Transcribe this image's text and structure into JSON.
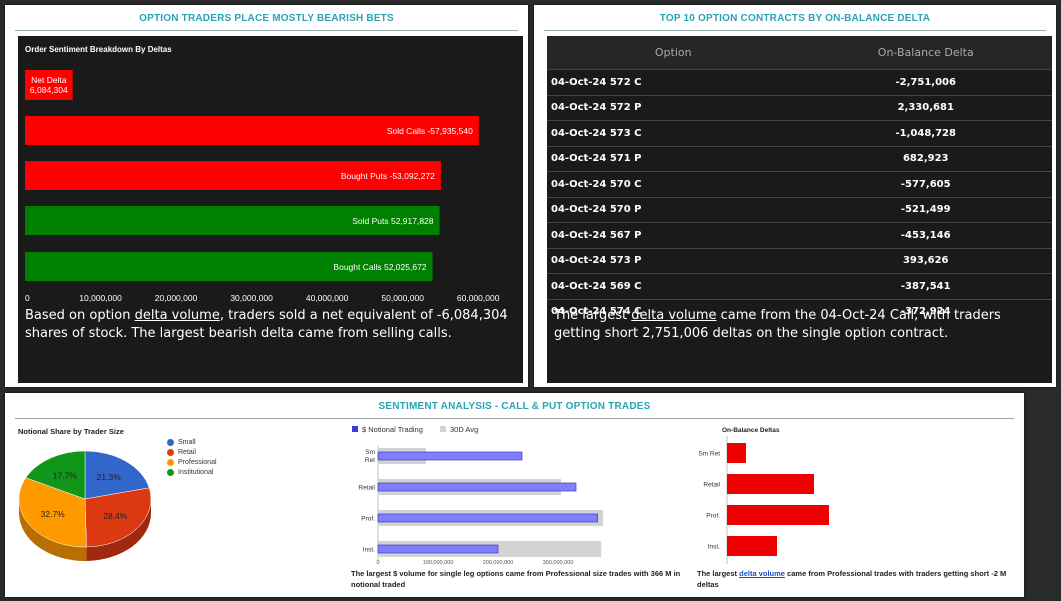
{
  "panel1": {
    "title": "OPTION TRADERS PLACE MOSTLY BEARISH BETS",
    "chart_title": "Order Sentiment Breakdown By Deltas",
    "description_pre": "Based on option ",
    "description_link": "delta volume",
    "description_post": ", traders sold a net equivalent of -6,084,304 shares of stock. The largest bearish delta came from selling calls."
  },
  "panel2": {
    "title": "TOP 10 OPTION CONTRACTS BY ON-BALANCE DELTA",
    "headers": [
      "Option",
      "On-Balance Delta"
    ],
    "rows": [
      [
        "04-Oct-24 572 C",
        "-2,751,006"
      ],
      [
        "04-Oct-24 572 P",
        "2,330,681"
      ],
      [
        "04-Oct-24 573 C",
        "-1,048,728"
      ],
      [
        "04-Oct-24 571 P",
        "682,923"
      ],
      [
        "04-Oct-24 570 C",
        "-577,605"
      ],
      [
        "04-Oct-24 570 P",
        "-521,499"
      ],
      [
        "04-Oct-24 567 P",
        "-453,146"
      ],
      [
        "04-Oct-24 573 P",
        "393,626"
      ],
      [
        "04-Oct-24 569 C",
        "-387,541"
      ],
      [
        "04-Oct-24 574 C",
        "-372,924"
      ]
    ],
    "description_pre": "The largest ",
    "description_link": "delta volume",
    "description_post": " came from the 04-Oct-24 Call, with traders getting short 2,751,006 deltas on the single option contract."
  },
  "panel3": {
    "title": "SENTIMENT ANALYSIS - CALL & PUT OPTION TRADES",
    "pie_title": "Notional Share by Trader Size",
    "notional_text": "The largest $ volume for single leg options came from Professional size trades with 366 M in notional traded",
    "delta_text_pre": "The largest ",
    "delta_text_link": "delta volume",
    "delta_text_post": " came from Professional trades with traders getting short -2 M deltas",
    "delta_chart_title": "On-Balance Deltas"
  },
  "colors": {
    "red": "#ff0000",
    "green": "#008000",
    "teal": "#2aa3b5"
  },
  "chart_data": [
    {
      "type": "bar",
      "title": "Order Sentiment Breakdown By Deltas",
      "orientation": "horizontal",
      "categories": [
        "Net Delta",
        "Sold Calls",
        "Bought Puts",
        "Sold Puts",
        "Bought Calls"
      ],
      "values": [
        -6084304,
        -57935540,
        -53092272,
        52917828,
        52025672
      ],
      "labels": [
        "Net Delta\n6,084,304",
        "Sold Calls -57,935,540",
        "Bought Puts -53,092,272",
        "Sold Puts 52,917,828",
        "Bought Calls 52,025,672"
      ],
      "colors": [
        "#ff0000",
        "#ff0000",
        "#ff0000",
        "#008000",
        "#008000"
      ],
      "xlim": [
        0,
        60000000
      ],
      "xticks": [
        "0",
        "10,000,000",
        "20,000,000",
        "30,000,000",
        "40,000,000",
        "50,000,000",
        "60,000,000"
      ]
    },
    {
      "type": "pie",
      "title": "Notional Share by Trader Size",
      "categories": [
        "Small",
        "Retail",
        "Professional",
        "Institutional"
      ],
      "values": [
        21.3,
        28.4,
        32.7,
        17.7
      ],
      "labels": [
        "21.3%",
        "28.4%",
        "32.7%",
        "17.7%"
      ],
      "colors": [
        "#3366cc",
        "#dc3912",
        "#ff9900",
        "#109618"
      ],
      "legend": "right"
    },
    {
      "type": "bar",
      "orientation": "horizontal",
      "categories": [
        "Sm Ret",
        "Retail",
        "Prof.",
        "Inst."
      ],
      "series": [
        {
          "name": "$ Notional Trading",
          "values": [
            240000000,
            330000000,
            366000000,
            200000000
          ],
          "color": "#8080ff"
        },
        {
          "name": "30D Avg",
          "values": [
            80000000,
            305000000,
            375000000,
            372000000
          ],
          "color": "#d3d3d3"
        }
      ],
      "xticks": [
        "0",
        "100,000,000",
        "200,000,000",
        "300,000,000"
      ],
      "xlim": [
        0,
        400000000
      ]
    },
    {
      "type": "bar",
      "title": "On-Balance Deltas",
      "orientation": "horizontal",
      "categories": [
        "Sm Ret",
        "Retail",
        "Prof.",
        "Inst."
      ],
      "values": [
        0.19,
        0.87,
        1.02,
        0.5
      ],
      "color": "#ee0000"
    }
  ]
}
